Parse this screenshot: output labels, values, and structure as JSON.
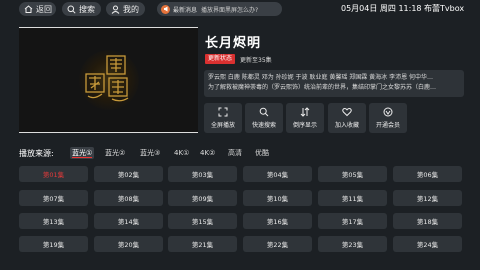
{
  "topbar": {
    "back_label": "返回",
    "search_label": "搜索",
    "mine_label": "我的",
    "news_label": "最新消息",
    "news_message": "播放界面黑屏怎么办?",
    "clock": "05月04日 周四 11:18",
    "brand": "布蕾Tvbox"
  },
  "show": {
    "title": "长月烬明",
    "status_badge": "更新状态",
    "update_text": "更新至35集",
    "description_line1": "罗云熙 白鹿 陈都灵 邓为 孙珍妮 于波 耿业庭 黄馨瑶 郑国霖 黄海冰 李沛恩 何中华…",
    "description_line2": "为了解救被魔神荼毒的（罗云熙饰）统治前辈的世界，集结印掌门之女黎苏苏（白鹿…"
  },
  "actions": [
    {
      "label": "全屏播放",
      "icon": "fullscreen-icon"
    },
    {
      "label": "快速搜索",
      "icon": "search-icon"
    },
    {
      "label": "倒序显示",
      "icon": "sort-icon"
    },
    {
      "label": "加入收藏",
      "icon": "heart-icon"
    },
    {
      "label": "开通会员",
      "icon": "vip-icon"
    }
  ],
  "sources": {
    "label": "播放来源:",
    "items": [
      "蓝光①",
      "蓝光②",
      "蓝光③",
      "4K①",
      "4K②",
      "高清",
      "优酷"
    ],
    "active_index": 0
  },
  "episodes": {
    "selected_index": 0,
    "items": [
      "第01集",
      "第02集",
      "第03集",
      "第04集",
      "第05集",
      "第06集",
      "第07集",
      "第08集",
      "第09集",
      "第10集",
      "第11集",
      "第12集",
      "第13集",
      "第14集",
      "第15集",
      "第16集",
      "第17集",
      "第18集",
      "第19集",
      "第20集",
      "第21集",
      "第22集",
      "第23集",
      "第24集"
    ]
  },
  "colors": {
    "accent_red": "#d93030",
    "news_dot": "#e5733b",
    "background": "#1c2024"
  }
}
